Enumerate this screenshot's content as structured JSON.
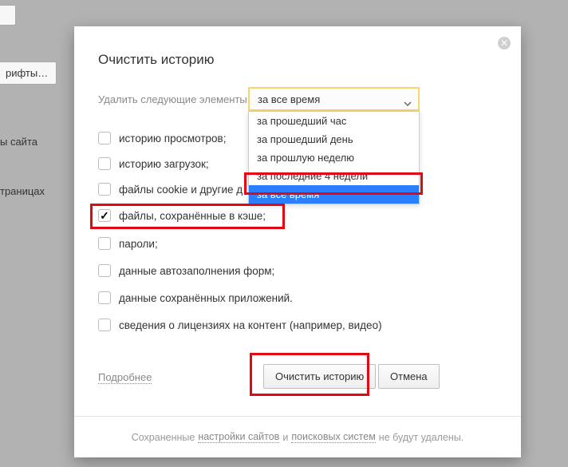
{
  "background": {
    "btn_top_partial": "рифты…",
    "label_site": "ы сайта",
    "label_pages": "траницах"
  },
  "dialog": {
    "title": "Очистить историю",
    "time_label": "Удалить следующие элементы:",
    "select_value": "за все время",
    "options": [
      "за прошедший час",
      "за прошедший день",
      "за прошлую неделю",
      "за последние 4 недели",
      "за все время"
    ],
    "items": [
      {
        "label": "историю просмотров;",
        "checked": false
      },
      {
        "label": "историю загрузок;",
        "checked": false
      },
      {
        "label": "файлы cookie и другие д",
        "checked": false
      },
      {
        "label": "файлы, сохранённые в кэше;",
        "checked": true
      },
      {
        "label": "пароли;",
        "checked": false
      },
      {
        "label": "данные автозаполнения форм;",
        "checked": false
      },
      {
        "label": "данные сохранённых приложений.",
        "checked": false
      },
      {
        "label": "сведения о лицензиях на контент (например, видео)",
        "checked": false
      }
    ],
    "more_link": "Подробнее",
    "primary_btn": "Очистить историю",
    "cancel_btn": "Отмена",
    "footer": {
      "pre": "Сохраненные",
      "link1": "настройки сайтов",
      "mid": "и",
      "link2": "поисковых систем",
      "post": "не будут удалены."
    }
  }
}
